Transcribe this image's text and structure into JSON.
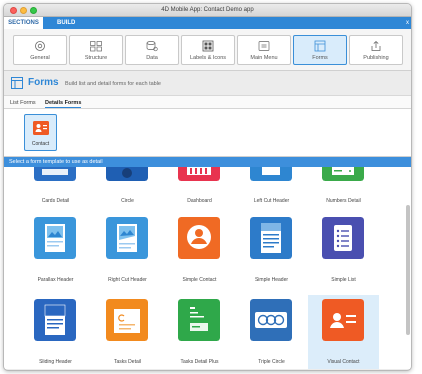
{
  "window": {
    "title": "4D Mobile App: Contact Demo app"
  },
  "tabs": {
    "sections": "SECTIONS",
    "build": "BUILD",
    "close": "x"
  },
  "sections": [
    {
      "label": "General",
      "icon": "gear-icon"
    },
    {
      "label": "Structure",
      "icon": "structure-icon"
    },
    {
      "label": "Data",
      "icon": "database-icon"
    },
    {
      "label": "Labels & Icons",
      "icon": "labels-icon"
    },
    {
      "label": "Main Menu",
      "icon": "menu-icon"
    },
    {
      "label": "Forms",
      "icon": "forms-icon"
    },
    {
      "label": "Publishing",
      "icon": "publish-icon"
    }
  ],
  "active_section": "Forms",
  "header": {
    "title": "Forms",
    "description": "Build list and detail forms for each table"
  },
  "subtabs": {
    "list": "List Forms",
    "details": "Details Forms"
  },
  "tables": [
    {
      "label": "Contact",
      "icon": "contact-card-icon"
    }
  ],
  "prompt": "Select a form template to use as detail",
  "templates": [
    {
      "name": "Cards Detail",
      "color": "#2b6fc4",
      "icon": "cards-detail-icon"
    },
    {
      "name": "Circle",
      "color": "#1f5fb3",
      "icon": "circle-icon"
    },
    {
      "name": "Dashboard",
      "color": "#e8344f",
      "icon": "dashboard-icon"
    },
    {
      "name": "Left Cut Header",
      "color": "#2e86d1",
      "icon": "left-cut-header-icon"
    },
    {
      "name": "Numbers Detail",
      "color": "#3aaa4a",
      "icon": "numbers-detail-icon"
    },
    {
      "name": "Parallax Header",
      "color": "#3a96db",
      "icon": "parallax-header-icon"
    },
    {
      "name": "Right Cut Header",
      "color": "#3a96db",
      "icon": "right-cut-header-icon"
    },
    {
      "name": "Simple Contact",
      "color": "#f06a24",
      "icon": "simple-contact-icon"
    },
    {
      "name": "Simple Header",
      "color": "#2d7bc9",
      "icon": "simple-header-icon"
    },
    {
      "name": "Simple List",
      "color": "#4a4fb0",
      "icon": "simple-list-icon"
    },
    {
      "name": "Sliding Header",
      "color": "#2a67c0",
      "icon": "sliding-header-icon"
    },
    {
      "name": "Tasks Detail",
      "color": "#f28a1e",
      "icon": "tasks-detail-icon"
    },
    {
      "name": "Tasks Detail Plus",
      "color": "#2fa84a",
      "icon": "tasks-detail-plus-icon"
    },
    {
      "name": "Triple Circle",
      "color": "#2f6fb8",
      "icon": "triple-circle-icon"
    },
    {
      "name": "Visual Contact",
      "color": "#ef5a24",
      "icon": "visual-contact-icon"
    }
  ],
  "selected_template": "Visual Contact"
}
